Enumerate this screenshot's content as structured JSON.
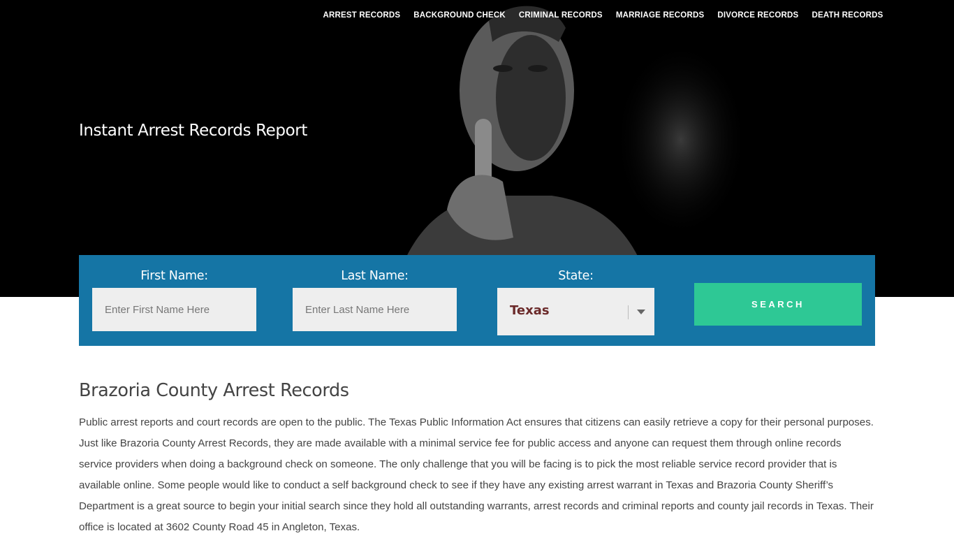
{
  "nav": {
    "items": [
      {
        "label": "ARREST RECORDS"
      },
      {
        "label": "BACKGROUND CHECK"
      },
      {
        "label": "CRIMINAL RECORDS"
      },
      {
        "label": "MARRIAGE RECORDS"
      },
      {
        "label": "DIVORCE RECORDS"
      },
      {
        "label": "DEATH RECORDS"
      }
    ]
  },
  "hero": {
    "title": "Instant Arrest Records Report"
  },
  "search": {
    "first_name_label": "First Name:",
    "first_name_placeholder": "Enter First Name Here",
    "last_name_label": "Last Name:",
    "last_name_placeholder": "Enter Last Name Here",
    "state_label": "State:",
    "state_value": "Texas",
    "button_label": "SEARCH"
  },
  "colors": {
    "panel": "#1575a5",
    "button": "#2ec895",
    "state_text": "#6b2a2a"
  },
  "content": {
    "title": "Brazoria County Arrest Records",
    "body": "Public arrest reports and court records are open to the public. The Texas Public Information Act ensures that citizens can easily retrieve a copy for their personal purposes. Just like Brazoria County Arrest Records, they are made available with a minimal service fee for public access and anyone can request them through online records service providers when doing a background check on someone. The only challenge that you will be facing is to pick the most reliable service record provider that is available online. Some people would like to conduct a self background check to see if they have any existing arrest warrant in Texas and Brazoria County Sheriff’s Department is a great source to begin your initial search since they hold all outstanding warrants, arrest records and criminal reports and county jail records in Texas. Their office is located at 3602 County Road 45 in Angleton, Texas."
  }
}
